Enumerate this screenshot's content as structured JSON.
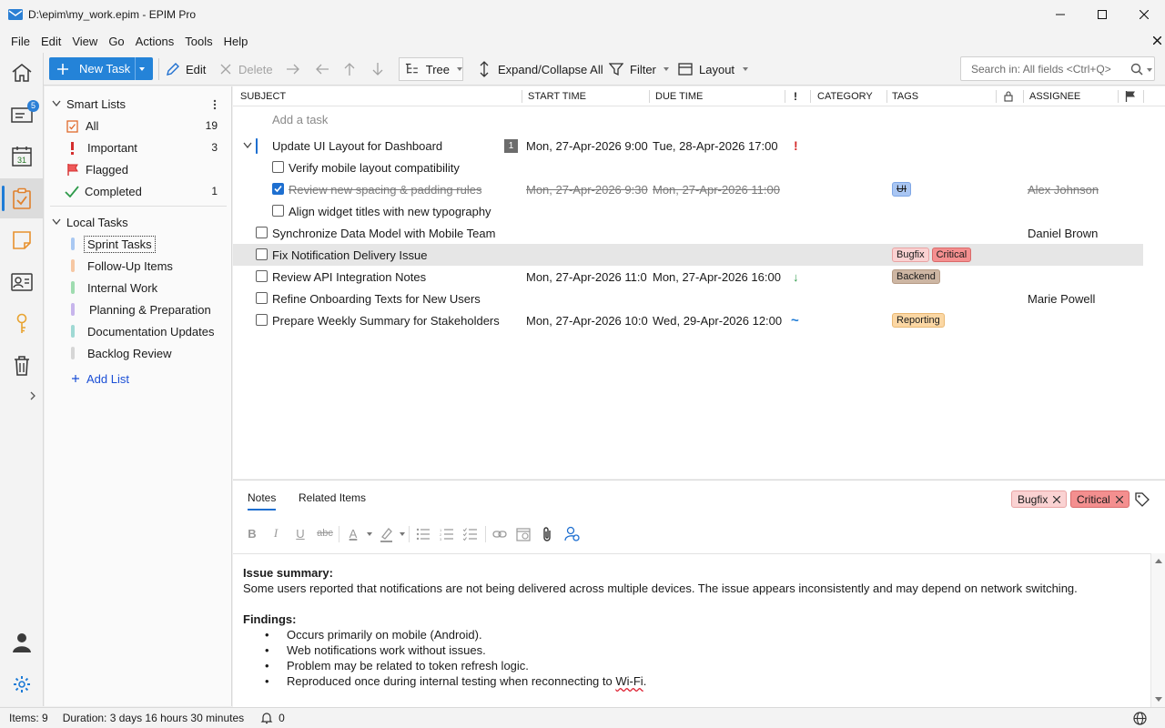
{
  "window": {
    "title": "D:\\epim\\my_work.epim - EPIM Pro"
  },
  "menu": [
    "File",
    "Edit",
    "View",
    "Go",
    "Actions",
    "Tools",
    "Help"
  ],
  "rail": {
    "mail_badge": "5",
    "calendar_day": "31"
  },
  "toolbar": {
    "new_task": "New Task",
    "edit": "Edit",
    "delete": "Delete",
    "view_mode": "Tree",
    "expand_collapse": "Expand/Collapse All",
    "filter": "Filter",
    "layout": "Layout",
    "search_placeholder": "Search in: All fields  <Ctrl+Q>"
  },
  "sidebar": {
    "smart_lists_title": "Smart Lists",
    "smart_lists": [
      {
        "label": "All",
        "count": "19",
        "icon": "clipboard-icon"
      },
      {
        "label": "Important",
        "count": "3",
        "icon": "exclamation-icon"
      },
      {
        "label": "Flagged",
        "count": "",
        "icon": "flag-icon"
      },
      {
        "label": "Completed",
        "count": "1",
        "icon": "checkmark-icon"
      }
    ],
    "local_tasks_title": "Local Tasks",
    "local_lists": [
      {
        "label": "Sprint Tasks",
        "color": "#a9c8f2"
      },
      {
        "label": "Follow-Up Items",
        "color": "#f6c7a3"
      },
      {
        "label": "Internal Work",
        "color": "#9fdcb0"
      },
      {
        "label": "Planning & Preparation",
        "color": "#c7b5ec"
      },
      {
        "label": "Documentation Updates",
        "color": "#9fd9d4"
      },
      {
        "label": "Backlog Review",
        "color": "#d6d6d6"
      }
    ],
    "add_list": "Add List"
  },
  "grid": {
    "columns": {
      "subject": "SUBJECT",
      "start": "START TIME",
      "due": "DUE TIME",
      "priority": "!",
      "category": "CATEGORY",
      "tags": "TAGS",
      "assignee": "ASSIGNEE"
    },
    "add_placeholder": "Add a task",
    "rows": [
      {
        "subject": "Update UI Layout for Dashboard",
        "count": "1",
        "start": "Mon, 27-Apr-2026 9:00",
        "due": "Tue, 28-Apr-2026 17:00",
        "priority": "!",
        "tags": [],
        "assignee": ""
      },
      {
        "subject": "Verify mobile layout compatibility",
        "start": "",
        "due": "",
        "tags": [],
        "assignee": ""
      },
      {
        "subject": "Review new spacing & padding rules",
        "start": "Mon, 27-Apr-2026 9:30",
        "due": "Mon, 27-Apr-2026 11:00",
        "tags": [
          "UI"
        ],
        "assignee": "Alex Johnson"
      },
      {
        "subject": "Align widget titles with new typography",
        "start": "",
        "due": "",
        "tags": [],
        "assignee": ""
      },
      {
        "subject": "Synchronize Data Model with Mobile Team",
        "start": "",
        "due": "",
        "tags": [],
        "assignee": "Daniel Brown"
      },
      {
        "subject": "Fix Notification Delivery Issue",
        "start": "",
        "due": "",
        "tags": [
          "Bugfix",
          "Critical"
        ],
        "assignee": ""
      },
      {
        "subject": "Review API Integration Notes",
        "start": "Mon, 27-Apr-2026 11:0",
        "due": "Mon, 27-Apr-2026 16:00",
        "priority": "↓",
        "tags": [
          "Backend"
        ],
        "assignee": ""
      },
      {
        "subject": "Refine Onboarding Texts for New Users",
        "start": "",
        "due": "",
        "tags": [],
        "assignee": "Marie Powell"
      },
      {
        "subject": "Prepare Weekly Summary for Stakeholders",
        "start": "Mon, 27-Apr-2026 10:0",
        "due": "Wed, 29-Apr-2026 12:00",
        "priority": "~",
        "tags": [
          "Reporting"
        ],
        "assignee": ""
      }
    ]
  },
  "tag_colors": {
    "UI": {
      "bg": "#a9c6f3",
      "border": "#7ea6e6"
    },
    "Bugfix": {
      "bg": "#fad2d2",
      "border": "#e8a3a3"
    },
    "Critical": {
      "bg": "#f48f8f",
      "border": "#d96a6a"
    },
    "Backend": {
      "bg": "#cdb6a3",
      "border": "#b69b85"
    },
    "Reporting": {
      "bg": "#fbd7a4",
      "border": "#e9b873"
    }
  },
  "details": {
    "tab_notes": "Notes",
    "tab_related": "Related Items",
    "tags": [
      "Bugfix",
      "Critical"
    ],
    "format_bold": "B",
    "format_italic": "I",
    "format_underline": "U",
    "format_strike": "abc",
    "format_color": "A",
    "summary_heading": "Issue summary:",
    "summary_text": "Some users reported that notifications are not being delivered across multiple devices. The issue appears inconsistently and may depend on network switching.",
    "findings_heading": "Findings:",
    "findings": [
      "Occurs primarily on mobile (Android).",
      "Web notifications work without issues.",
      "Problem may be related to token refresh logic.",
      "Reproduced once during internal testing when reconnecting to "
    ],
    "findings_last_word": "Wi-Fi",
    "findings_last_suffix": "."
  },
  "status": {
    "items": "Items: 9",
    "duration": "Duration: 3 days 16 hours 30 minutes",
    "reminders": "0"
  }
}
